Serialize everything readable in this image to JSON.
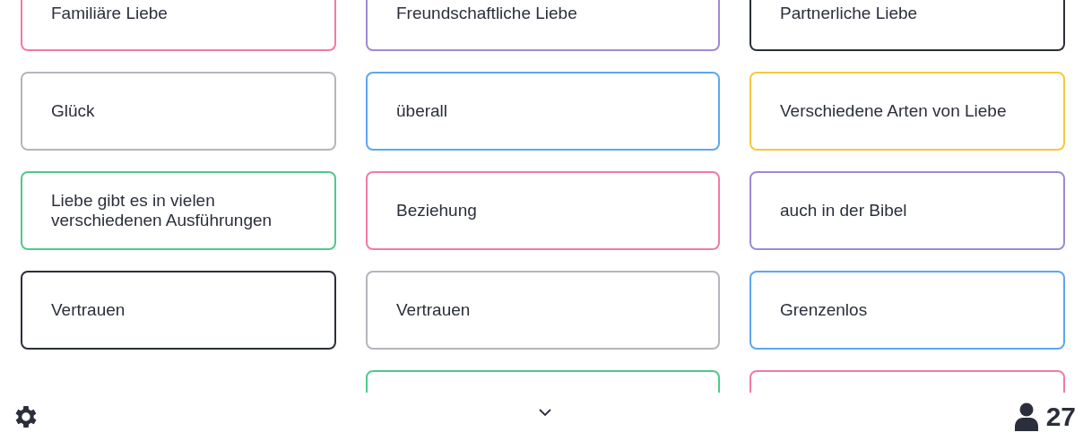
{
  "columns": [
    {
      "cards": [
        {
          "text": "Familiäre Liebe",
          "color": "#f27aa3"
        },
        {
          "text": "Glück",
          "color": "#b5b5bd"
        },
        {
          "text": "Liebe gibt es in vielen verschiedenen Ausführungen",
          "color": "#4fc98c"
        },
        {
          "text": "Vertrauen",
          "color": "#2b2f3b"
        }
      ]
    },
    {
      "cards": [
        {
          "text": "Freundschaftliche Liebe",
          "color": "#9d89d8"
        },
        {
          "text": "überall",
          "color": "#5ea6f0"
        },
        {
          "text": "Beziehung",
          "color": "#f27aa3"
        },
        {
          "text": "Vertrauen",
          "color": "#b5b5bd"
        },
        {
          "color": "#4fc98c"
        }
      ]
    },
    {
      "cards": [
        {
          "text": "Partnerliche Liebe",
          "color": "#2b2f3b"
        },
        {
          "text": "Verschiedene Arten von Liebe",
          "color": "#f5c83c"
        },
        {
          "text": "auch in der Bibel",
          "color": "#9d89d8"
        },
        {
          "text": "Grenzenlos",
          "color": "#5ea6f0"
        },
        {
          "color": "#f27aa3"
        }
      ]
    }
  ],
  "footer": {
    "participants": "27"
  }
}
